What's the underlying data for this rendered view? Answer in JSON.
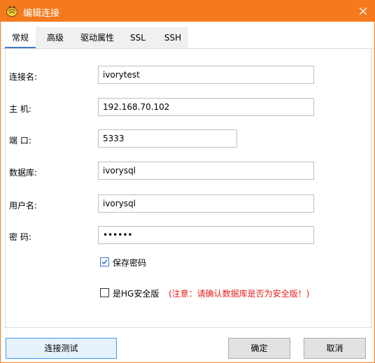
{
  "window": {
    "title": "编辑连接",
    "close_icon": "close-icon"
  },
  "tabs": [
    {
      "label": "常规",
      "active": true
    },
    {
      "label": "高级"
    },
    {
      "label": "驱动属性"
    },
    {
      "label": "SSL"
    },
    {
      "label": "SSH"
    }
  ],
  "form": {
    "connection_name": {
      "label": "连接名:",
      "value": "ivorytest"
    },
    "host": {
      "label": "主  机:",
      "value": "192.168.70.102"
    },
    "port": {
      "label": "端  口:",
      "value": "5333"
    },
    "database": {
      "label": "数据库:",
      "value": "ivorysql"
    },
    "username": {
      "label": "用户名:",
      "value": "ivorysql"
    },
    "password": {
      "label": "密  码:",
      "value": "••••••"
    },
    "save_password": {
      "label": "保存密码",
      "checked": true
    },
    "hg_security": {
      "label": "是HG安全版",
      "checked": false,
      "warning": "(注意：请确认数据库是否为安全版！)"
    }
  },
  "buttons": {
    "test": "连接测试",
    "ok": "确定",
    "cancel": "取消"
  },
  "colors": {
    "accent": "#f47a1d",
    "warning": "#e81d1d",
    "focus": "#3c9cf0"
  }
}
